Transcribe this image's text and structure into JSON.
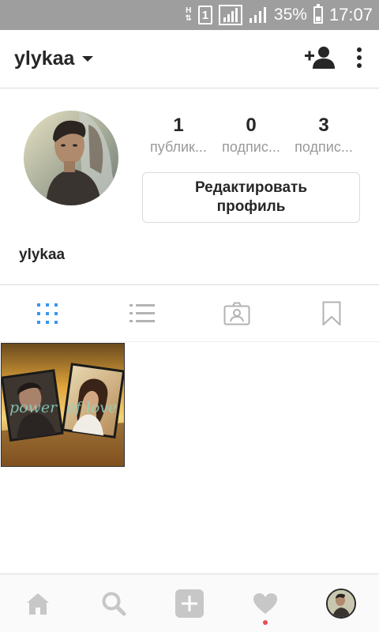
{
  "status_bar": {
    "network_type": "H",
    "sim_slot": "1",
    "battery_percent": "35%",
    "time": "17:07"
  },
  "header": {
    "username": "ylykaa",
    "icons": [
      "add-person-icon",
      "more-vert-icon"
    ]
  },
  "profile": {
    "stats": [
      {
        "value": "1",
        "label": "публик..."
      },
      {
        "value": "0",
        "label": "подпис..."
      },
      {
        "value": "3",
        "label": "подпис..."
      }
    ],
    "edit_button_label": "Редактировать\nпрофиль",
    "display_name": "ylykaa"
  },
  "tabs": [
    {
      "icon": "grid-icon",
      "active": true
    },
    {
      "icon": "list-icon",
      "active": false
    },
    {
      "icon": "tagged-icon",
      "active": false
    },
    {
      "icon": "bookmark-icon",
      "active": false
    }
  ],
  "posts": [
    {
      "caption_overlay": "power  of love"
    }
  ],
  "bottom_nav": [
    {
      "icon": "home-icon"
    },
    {
      "icon": "search-icon"
    },
    {
      "icon": "add-post-icon"
    },
    {
      "icon": "heart-icon",
      "has_notification": true
    },
    {
      "icon": "profile-avatar"
    }
  ],
  "colors": {
    "status_bar_bg": "#9e9e9e",
    "active_tab": "#3897f0",
    "inactive_icon": "#b3b3b3",
    "text": "#262626",
    "muted_text": "#999999",
    "notification_dot": "#ed4956"
  }
}
